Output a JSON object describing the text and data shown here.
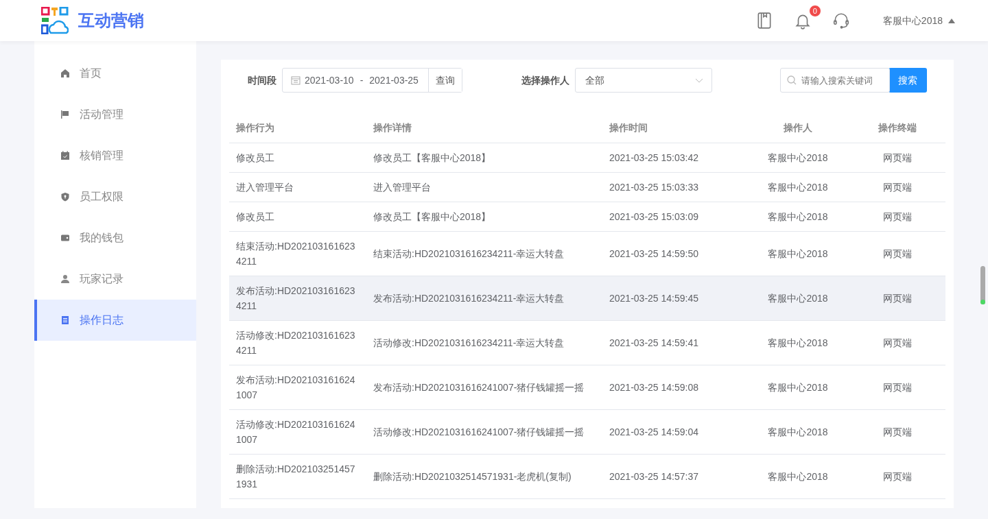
{
  "header": {
    "app_name": "互动营销",
    "notification_count": "0",
    "user_name": "客服中心2018"
  },
  "sidebar": {
    "items": [
      {
        "label": "首页",
        "selected": false
      },
      {
        "label": "活动管理",
        "selected": false
      },
      {
        "label": "核销管理",
        "selected": false
      },
      {
        "label": "员工权限",
        "selected": false
      },
      {
        "label": "我的钱包",
        "selected": false
      },
      {
        "label": "玩家记录",
        "selected": false
      },
      {
        "label": "操作日志",
        "selected": true
      }
    ]
  },
  "filters": {
    "date_label": "时间段",
    "date_start": "2021-03-10",
    "date_separator": "-",
    "date_end": "2021-03-25",
    "query_button": "查询",
    "operator_label": "选择操作人",
    "operator_value": "全部",
    "search_placeholder": "请输入搜索关键词",
    "search_button": "搜索"
  },
  "table": {
    "columns": [
      "操作行为",
      "操作详情",
      "操作时间",
      "操作人",
      "操作终端"
    ],
    "rows": [
      {
        "cells": [
          "修改员工",
          "修改员工【客服中心2018】",
          "2021-03-25 15:03:42",
          "客服中心2018",
          "网页端"
        ],
        "highlighted": false
      },
      {
        "cells": [
          "进入管理平台",
          "进入管理平台",
          "2021-03-25 15:03:33",
          "客服中心2018",
          "网页端"
        ],
        "highlighted": false
      },
      {
        "cells": [
          "修改员工",
          "修改员工【客服中心2018】",
          "2021-03-25 15:03:09",
          "客服中心2018",
          "网页端"
        ],
        "highlighted": false
      },
      {
        "cells": [
          "结束活动:HD2021031616234211",
          "结束活动:HD2021031616234211-幸运大转盘",
          "2021-03-25 14:59:50",
          "客服中心2018",
          "网页端"
        ],
        "highlighted": false
      },
      {
        "cells": [
          "发布活动:HD2021031616234211",
          "发布活动:HD2021031616234211-幸运大转盘",
          "2021-03-25 14:59:45",
          "客服中心2018",
          "网页端"
        ],
        "highlighted": true
      },
      {
        "cells": [
          "活动修改:HD2021031616234211",
          "活动修改:HD2021031616234211-幸运大转盘",
          "2021-03-25 14:59:41",
          "客服中心2018",
          "网页端"
        ],
        "highlighted": false
      },
      {
        "cells": [
          "发布活动:HD2021031616241007",
          "发布活动:HD2021031616241007-猪仔钱罐摇一摇",
          "2021-03-25 14:59:08",
          "客服中心2018",
          "网页端"
        ],
        "highlighted": false
      },
      {
        "cells": [
          "活动修改:HD2021031616241007",
          "活动修改:HD2021031616241007-猪仔钱罐摇一摇",
          "2021-03-25 14:59:04",
          "客服中心2018",
          "网页端"
        ],
        "highlighted": false
      },
      {
        "cells": [
          "删除活动:HD2021032514571931",
          "删除活动:HD2021032514571931-老虎机(复制)",
          "2021-03-25 14:57:37",
          "客服中心2018",
          "网页端"
        ],
        "highlighted": false
      }
    ]
  }
}
